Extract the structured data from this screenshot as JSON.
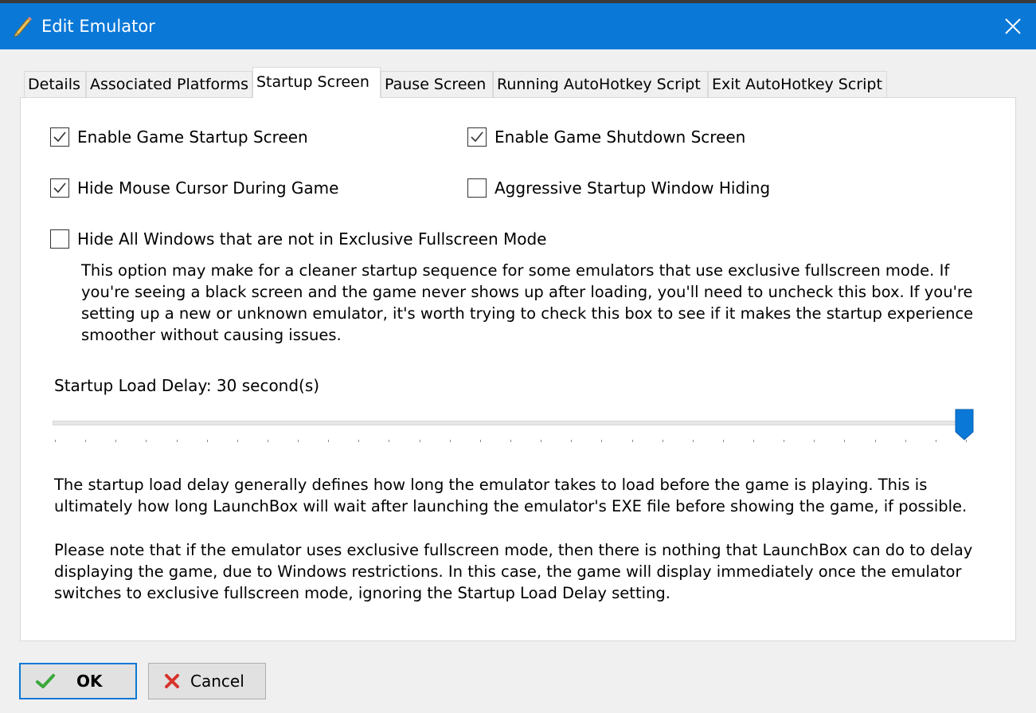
{
  "window": {
    "title": "Edit Emulator",
    "icon": "pencil-icon",
    "close_icon": "close-icon"
  },
  "tabs": [
    {
      "label": "Details",
      "active": false
    },
    {
      "label": "Associated Platforms",
      "active": false
    },
    {
      "label": "Startup Screen",
      "active": true
    },
    {
      "label": "Pause Screen",
      "active": false
    },
    {
      "label": "Running AutoHotkey Script",
      "active": false
    },
    {
      "label": "Exit AutoHotkey Script",
      "active": false
    }
  ],
  "options": {
    "enable_startup": {
      "label": "Enable Game Startup Screen",
      "checked": true
    },
    "enable_shutdown": {
      "label": "Enable Game Shutdown Screen",
      "checked": true
    },
    "hide_cursor": {
      "label": "Hide Mouse Cursor During Game",
      "checked": true
    },
    "aggressive_hiding": {
      "label": "Aggressive Startup Window Hiding",
      "checked": false
    },
    "hide_windows": {
      "label": "Hide All Windows that are not in Exclusive Fullscreen Mode",
      "checked": false
    }
  },
  "hide_windows_help": [
    "This option may make for a cleaner startup sequence for some emulators that use exclusive fullscreen mode. If",
    "you're seeing a black screen and the game never shows up after loading, you'll need to uncheck this box. If you're",
    "setting up a new or unknown emulator, it's worth trying to check this box to see if it makes the startup experience",
    "smoother without causing issues."
  ],
  "delay": {
    "label": "Startup Load Delay: 30 second(s)",
    "value": 30,
    "min": 0,
    "max": 30
  },
  "delay_help_1": [
    "The startup load delay generally defines how long the emulator takes to load before the game is playing. This is",
    "ultimately how long LaunchBox will wait after launching the emulator's EXE file before showing the game, if possible."
  ],
  "delay_help_2": [
    "Please note that if the emulator uses exclusive fullscreen mode, then there is nothing that LaunchBox can do to delay",
    "displaying the game, due to Windows restrictions. In this case, the game will display immediately once the emulator",
    "switches to exclusive fullscreen mode, ignoring the Startup Load Delay setting."
  ],
  "buttons": {
    "ok": {
      "label": "OK",
      "icon": "checkmark-icon"
    },
    "cancel": {
      "label": "Cancel",
      "icon": "red-x-icon"
    }
  },
  "colors": {
    "titlebar": "#0a78d7",
    "accent": "#0a78d7"
  }
}
